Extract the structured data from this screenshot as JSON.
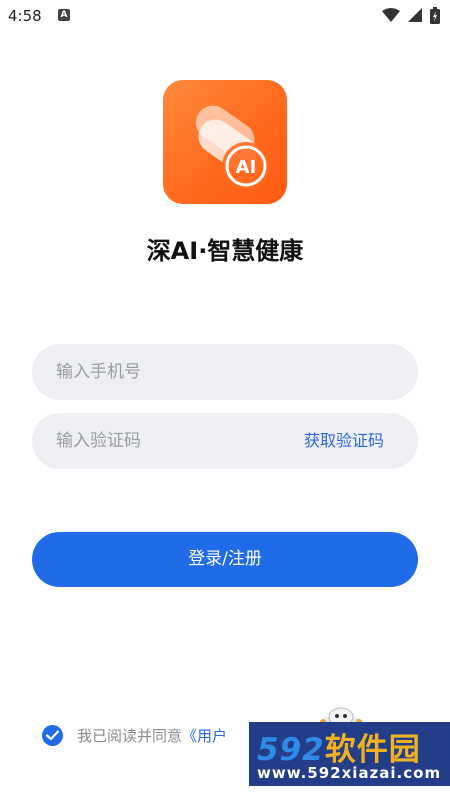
{
  "status_bar": {
    "time": "4:58",
    "a_icon_letter": "A"
  },
  "app": {
    "icon_letters": "AI",
    "title": "深AI·智慧健康"
  },
  "phone_input": {
    "placeholder": "输入手机号"
  },
  "code_input": {
    "placeholder": "输入验证码",
    "get_code_label": "获取验证码"
  },
  "login_button_label": "登录/注册",
  "agreement": {
    "checked": true,
    "text": "我已阅读并同意",
    "link_text": "《用户"
  },
  "watermark": {
    "number": "592",
    "chinese": "软件园",
    "url": "www.592xiazai.com"
  },
  "colors": {
    "primary": "#1f6be8",
    "link": "#2d69d6",
    "icon_orange": "#ff6a1f",
    "input_bg": "#eeeff3"
  }
}
